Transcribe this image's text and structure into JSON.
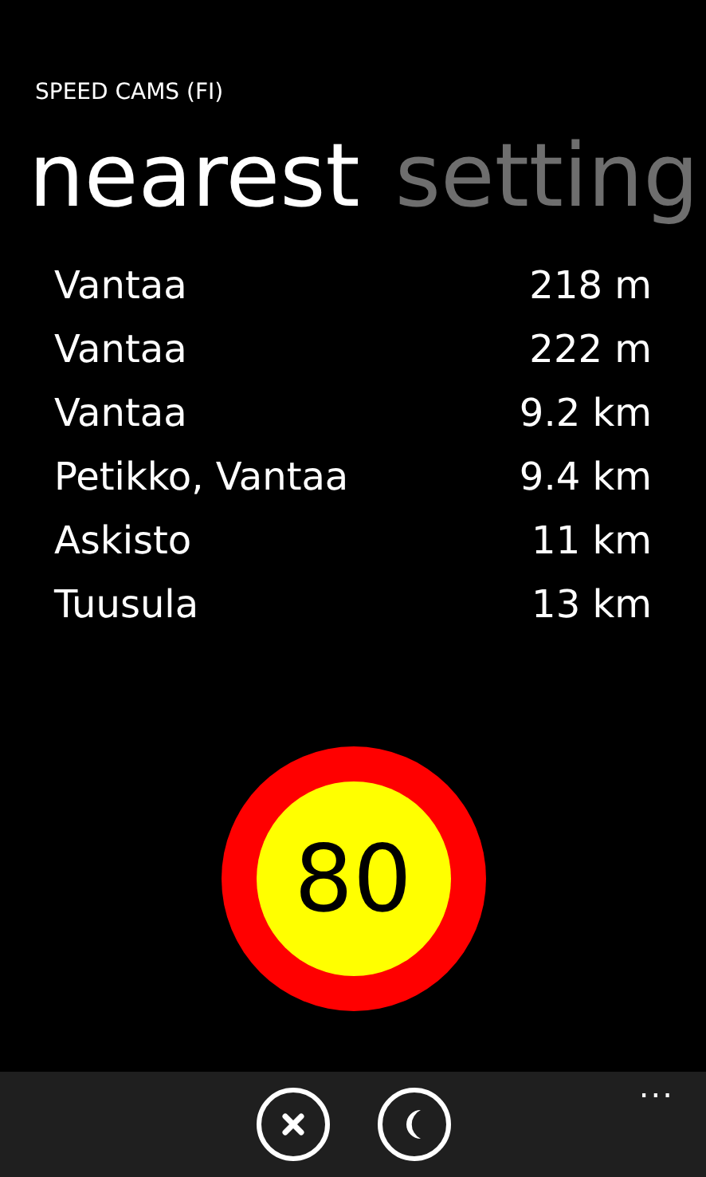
{
  "app_title": "SPEED CAMS (FI)",
  "pivots": [
    {
      "label": "nearest",
      "selected": true
    },
    {
      "label": "setting",
      "selected": false
    }
  ],
  "cameras": [
    {
      "place": "Vantaa",
      "distance": "218 m"
    },
    {
      "place": "Vantaa",
      "distance": "222 m"
    },
    {
      "place": "Vantaa",
      "distance": "9.2 km"
    },
    {
      "place": "Petikko, Vantaa",
      "distance": "9.4 km"
    },
    {
      "place": "Askisto",
      "distance": "11 km"
    },
    {
      "place": "Tuusula",
      "distance": "13 km"
    }
  ],
  "speed_limit": "80",
  "app_bar": {
    "buttons": [
      {
        "kind": "close"
      },
      {
        "kind": "moon"
      }
    ],
    "more": "..."
  }
}
